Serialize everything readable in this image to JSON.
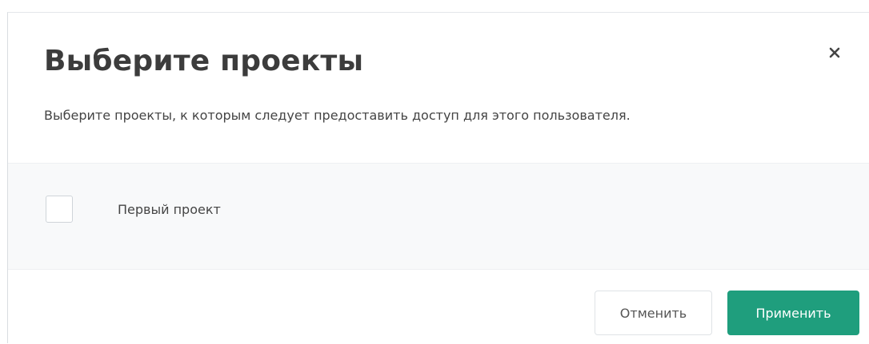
{
  "modal": {
    "title": "Выберите проекты",
    "description": "Выберите проекты, к которым следует предоставить доступ для этого пользователя.",
    "close_icon": "close-icon"
  },
  "projects": [
    {
      "label": "Первый проект",
      "checked": false
    }
  ],
  "footer": {
    "cancel_label": "Отменить",
    "apply_label": "Применить"
  },
  "colors": {
    "accent": "#1f9e7d",
    "body_background": "#f8f9fa",
    "title_text": "#3c3c3c"
  }
}
